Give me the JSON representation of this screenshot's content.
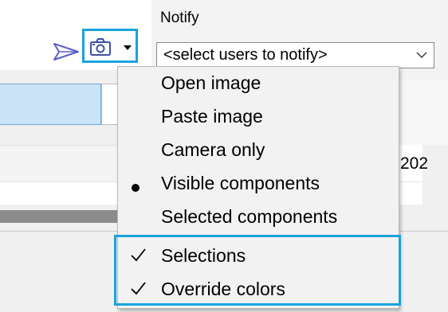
{
  "header": {
    "notify_label": "Notify",
    "notify_select_value": "<select users to notify>"
  },
  "icons": {
    "send": "send-icon",
    "camera": "camera-icon",
    "caret": "caret-down-icon",
    "chevron": "chevron-down-icon",
    "check": "check-icon",
    "bullet": "bullet-icon"
  },
  "grid": {
    "cell_partial_text": "202"
  },
  "menu": {
    "items": [
      {
        "label": "Open image",
        "mark": ""
      },
      {
        "label": "Paste image",
        "mark": ""
      },
      {
        "label": "Camera only",
        "mark": ""
      },
      {
        "label": "Visible components",
        "mark": "bullet"
      },
      {
        "label": "Selected components",
        "mark": ""
      },
      {
        "label": "Selections",
        "mark": "check"
      },
      {
        "label": "Override colors",
        "mark": "check"
      }
    ]
  },
  "colors": {
    "highlight": "#1aa3dc",
    "selected_cell": "#cce4f7",
    "send_icon": "#5b5fc7"
  }
}
